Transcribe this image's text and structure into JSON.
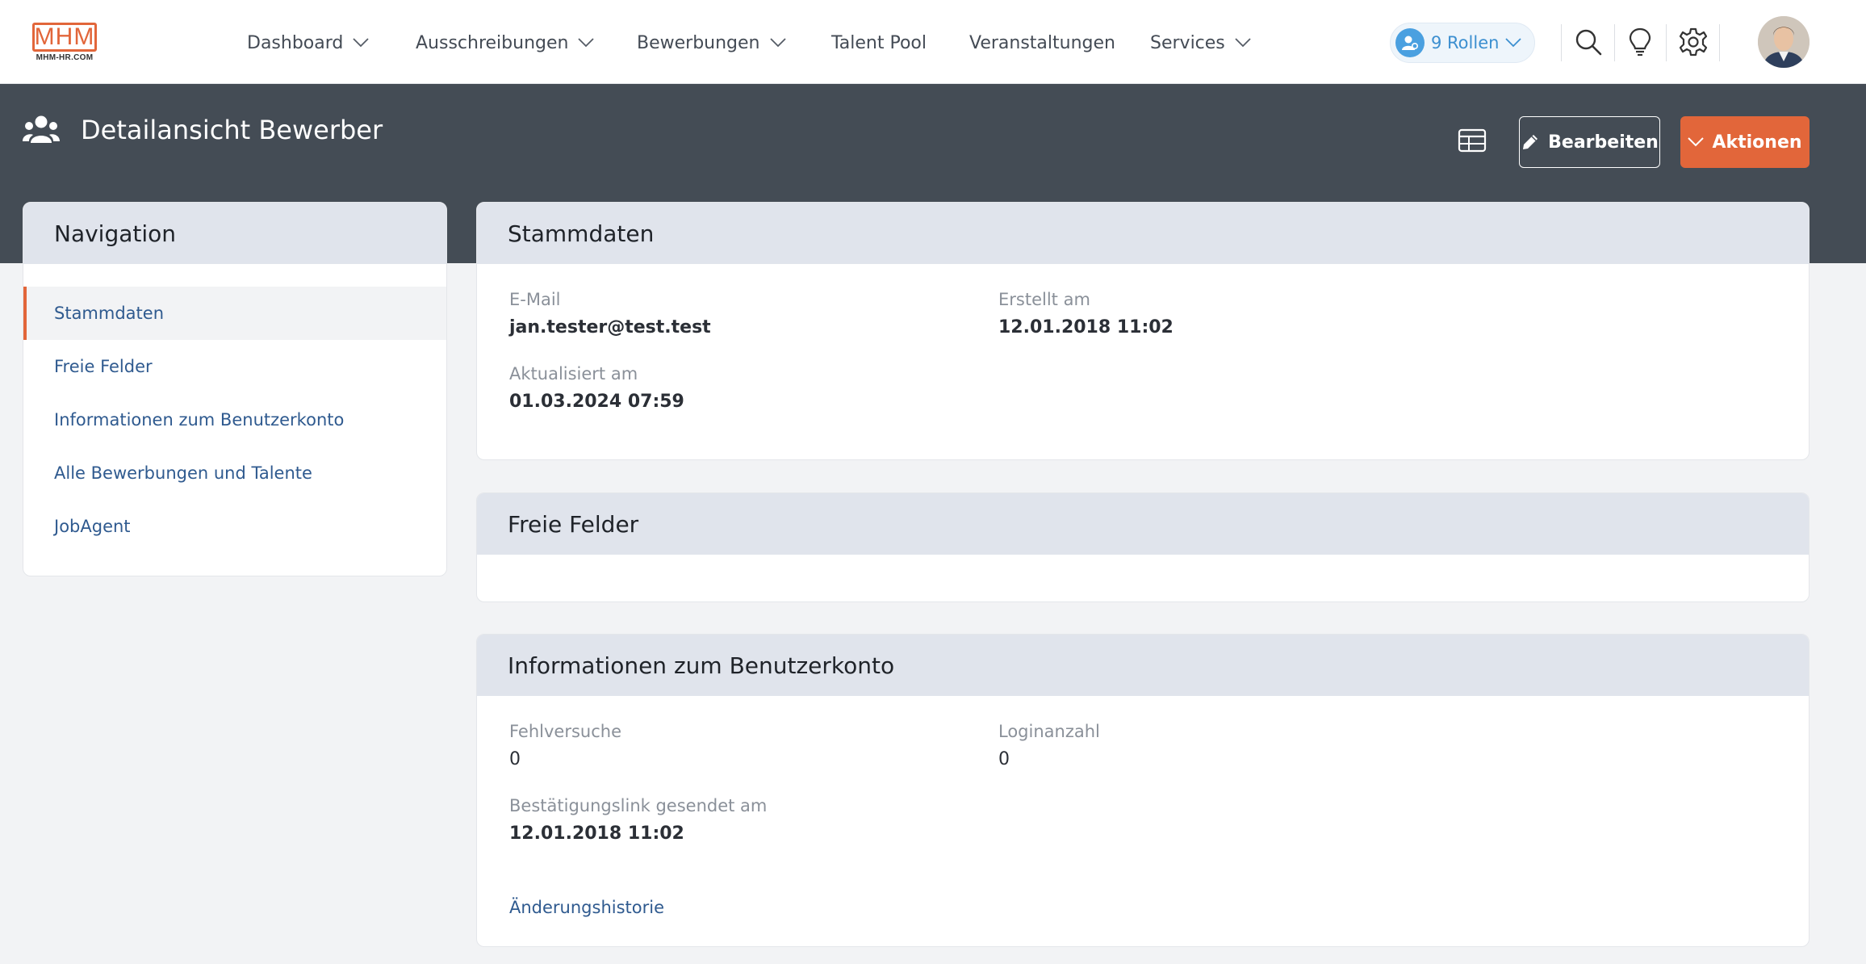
{
  "brand": {
    "logo_text": "MHM",
    "logo_sub": "MHM-HR.COM",
    "accent": "#e2663a"
  },
  "topnav": {
    "items": [
      {
        "label": "Dashboard",
        "dropdown": true
      },
      {
        "label": "Ausschreibungen",
        "dropdown": true
      },
      {
        "label": "Bewerbungen",
        "dropdown": true
      },
      {
        "label": "Talent Pool",
        "dropdown": false
      },
      {
        "label": "Veranstaltungen",
        "dropdown": false
      },
      {
        "label": "Services",
        "dropdown": true
      }
    ],
    "roles_label": "9 Rollen",
    "icons": [
      "search-icon",
      "lightbulb-icon",
      "gear-icon"
    ]
  },
  "header": {
    "title": "Detailansicht Bewerber",
    "icon": "users-icon",
    "edit_label": "Bearbeiten",
    "actions_label": "Aktionen"
  },
  "sidebar": {
    "title": "Navigation",
    "items": [
      {
        "label": "Stammdaten",
        "active": true
      },
      {
        "label": "Freie Felder",
        "active": false
      },
      {
        "label": "Informationen zum Benutzerkonto",
        "active": false
      },
      {
        "label": "Alle Bewerbungen und Talente",
        "active": false
      },
      {
        "label": "JobAgent",
        "active": false
      }
    ]
  },
  "stammdaten": {
    "title": "Stammdaten",
    "email_label": "E-Mail",
    "email_value": "jan.tester@test.test",
    "created_label": "Erstellt am",
    "created_value": "12.01.2018 11:02",
    "updated_label": "Aktualisiert am",
    "updated_value": "01.03.2024 07:59"
  },
  "freie_felder": {
    "title": "Freie Felder"
  },
  "benutzerkonto": {
    "title": "Informationen zum Benutzerkonto",
    "failed_label": "Fehlversuche",
    "failed_value": "0",
    "logins_label": "Loginanzahl",
    "logins_value": "0",
    "confirm_label": "Bestätigungslink gesendet am",
    "confirm_value": "12.01.2018 11:02",
    "history_link": "Änderungshistorie"
  }
}
